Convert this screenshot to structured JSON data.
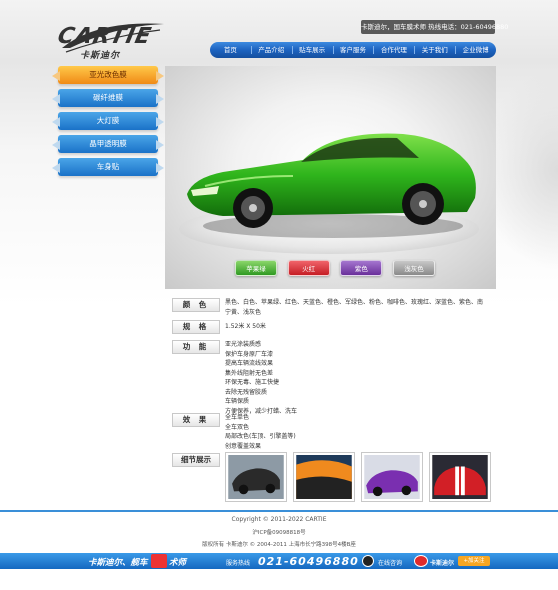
{
  "header": {
    "logo_text": "CARTIE",
    "logo_sub": "卡斯迪尔",
    "hotline": "卡斯迪尔，国车膜术师 热线电话：021-60496880"
  },
  "nav": {
    "items": [
      {
        "label": "首页"
      },
      {
        "label": "产品介绍"
      },
      {
        "label": "贴车展示"
      },
      {
        "label": "客户服务"
      },
      {
        "label": "合作代理"
      },
      {
        "label": "关于我们"
      },
      {
        "label": "企业微博"
      }
    ]
  },
  "sidebar": {
    "items": [
      {
        "label": "亚光改色膜",
        "active": true
      },
      {
        "label": "碳纤维膜",
        "active": false
      },
      {
        "label": "大灯膜",
        "active": false
      },
      {
        "label": "晶甲透明膜",
        "active": false
      },
      {
        "label": "车身贴",
        "active": false
      }
    ]
  },
  "hero": {
    "swatches": [
      {
        "label": "苹果绿",
        "color": "#3fa532"
      },
      {
        "label": "火红",
        "color": "#d7262c"
      },
      {
        "label": "紫色",
        "color": "#7b3fa8"
      },
      {
        "label": "浅灰色",
        "color": "#9a9a9a"
      }
    ]
  },
  "details": {
    "color_label": "颜 色",
    "color_text": "黑色、白色、苹果绿、红色、天蓝色、橙色、军绿色、粉色、咖啡色、玫瑰红、深蓝色、紫色、南宁黄、浅灰色",
    "spec_label": "规 格",
    "spec_text": "1.52米 X 50米",
    "function_label": "功 能",
    "function_lines": [
      "亚光涂装质感",
      "保护车身原厂车漆",
      "提高车辆流线效果",
      "集外线阻射无色差",
      "环保无毒、施工快捷",
      "去除无残留胶质",
      "车辆保质",
      "方便保养，减少打蜡、洗车"
    ],
    "effect_label": "效 果",
    "effect_lines": [
      "全车单色",
      "全车双色",
      "局部改色(车顶、引擎盖等)",
      "创意覆盖效果"
    ],
    "gallery_label": "细节展示"
  },
  "footer": {
    "copyright": "Copyright © 2011-2022 CARTIE",
    "icp": "沪ICP备09098818号",
    "rights": "版权所有 卡斯迪尔 © 2004-2011 上海市长宁路398号4楼B座",
    "slogan_a": "卡斯迪尔、舰车",
    "slogan_b": "术师",
    "service_label": "服务热线",
    "service_phone": "021-60496880",
    "online_label": "在线咨询",
    "weibo_label": "卡斯迪尔",
    "follow_label": "+加关注"
  }
}
